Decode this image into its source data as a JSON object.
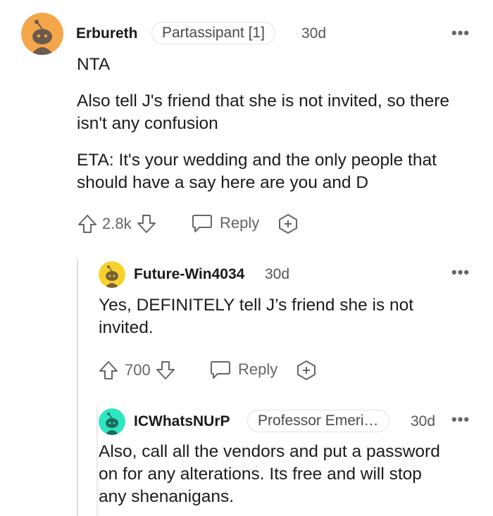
{
  "comments": [
    {
      "username": "Erbureth",
      "flair": "Partassipant [1]",
      "age": "30d",
      "more": "•••",
      "paragraphs": [
        "NTA",
        "Also tell J's friend that she is not invited, so there isn't any confusion",
        "ETA: It's your wedding and the only people that should have a say here are you and D"
      ],
      "score": "2.8k",
      "reply_label": "Reply",
      "avatar_color": "#f4a64b"
    },
    {
      "username": "Future-Win4034",
      "age": "30d",
      "more": "•••",
      "paragraphs": [
        "Yes, DEFINITELY tell J’s friend she is not invited."
      ],
      "score": "700",
      "reply_label": "Reply",
      "avatar_color": "#f7d22c"
    },
    {
      "username": "ICWhatsNUrP",
      "flair": "Professor Emeri…",
      "age": "30d",
      "more": "•••",
      "paragraphs": [
        "Also, call all the vendors and put a password on for any alterations. Its free and will stop any shenanigans."
      ],
      "avatar_color": "#2ee6c1"
    }
  ],
  "icons": {
    "upvote": "upvote-icon",
    "downvote": "downvote-icon",
    "reply": "reply-bubble-icon",
    "award": "award-plus-icon",
    "more": "more-options-icon"
  }
}
